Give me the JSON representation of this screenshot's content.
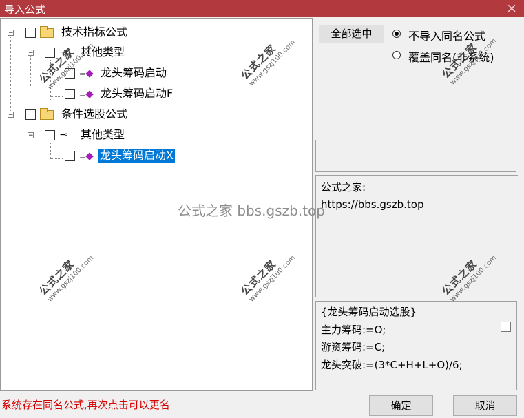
{
  "window": {
    "title": "导入公式",
    "close_glyph": "×"
  },
  "tree": {
    "nodes": [
      {
        "label": "技术指标公式"
      },
      {
        "label": "其他类型"
      },
      {
        "label": "龙头筹码启动"
      },
      {
        "label": "龙头筹码启动F"
      },
      {
        "label": "条件选股公式"
      },
      {
        "label": "其他类型"
      },
      {
        "label": "龙头筹码启动X",
        "selected": true
      }
    ],
    "expander_glyph": "−"
  },
  "buttons": {
    "select_all": "全部选中",
    "ok": "确定",
    "cancel": "取消"
  },
  "options": {
    "skip_same_name": {
      "label": "不导入同名公式",
      "checked": true
    },
    "overwrite_same_name": {
      "label": "覆盖同名(非系统)",
      "checked": false
    }
  },
  "info": {
    "line1": "公式之家:",
    "line2": "https://bbs.gszb.top"
  },
  "code": {
    "lines": [
      "{龙头筹码启动选股}",
      "主力筹码:=O;",
      "游资筹码:=C;",
      "龙头突破:=(3*C+H+L+O)/6;"
    ]
  },
  "status": {
    "message": "系统存在同名公式,再次点击可以更名"
  },
  "watermarks": {
    "brand": "公式之家",
    "url": "www.gszj100.com",
    "center": "公式之家 bbs.gszb.top"
  },
  "colors": {
    "titlebar": "#b23a3e",
    "selection": "#0078d7",
    "status": "#d40000"
  }
}
